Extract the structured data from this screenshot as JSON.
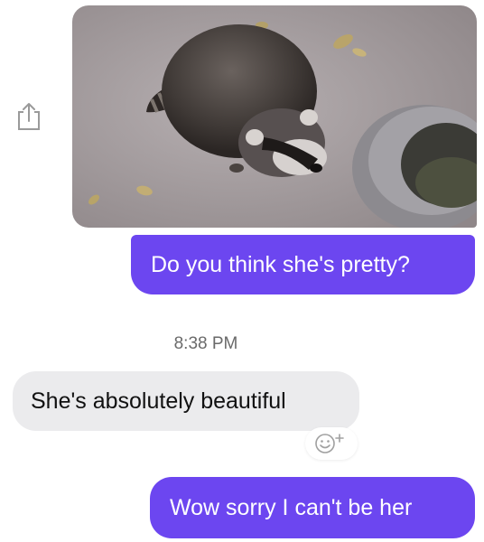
{
  "conversation": {
    "timestamp": "8:38 PM",
    "messages": [
      {
        "direction": "outgoing",
        "type": "image",
        "image_description_icon": "raccoon-photo"
      },
      {
        "direction": "outgoing",
        "type": "text",
        "text": "Do you think she's pretty?"
      },
      {
        "direction": "incoming",
        "type": "text",
        "text": "She's absolutely beautiful"
      },
      {
        "direction": "outgoing",
        "type": "text",
        "text": "Wow sorry I can't be her"
      }
    ]
  },
  "icons": {
    "share": "share-icon",
    "reaction": "add-reaction-icon"
  },
  "colors": {
    "outgoing_bubble": "#6c46f0",
    "incoming_bubble": "#ebebed",
    "timestamp_text": "#6a6a6a"
  }
}
